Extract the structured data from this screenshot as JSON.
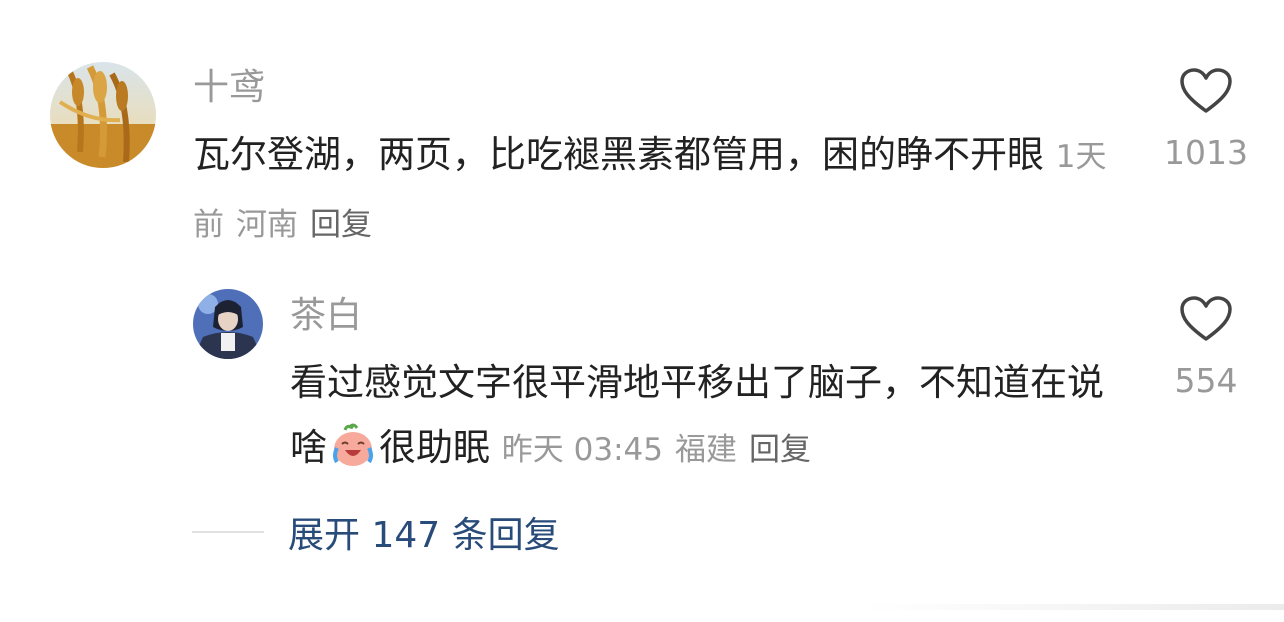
{
  "comments": [
    {
      "username": "十鸢",
      "text": "瓦尔登湖，两页，比吃褪黑素都管用，困的睁不开眼",
      "time": "1天前",
      "location": "河南",
      "reply_label": "回复",
      "like_count": "1013"
    },
    {
      "username": "茶白",
      "text_before_emoji": "看过感觉文字很平滑地平移出了脑子，不知道在说啥",
      "text_after_emoji": "很助眠",
      "time": "昨天 03:45",
      "location": "福建",
      "reply_label": "回复",
      "like_count": "554"
    }
  ],
  "expand_replies": "展开 147 条回复",
  "colors": {
    "username": "#999999",
    "body_text": "#222222",
    "meta": "#999999",
    "expand_link": "#284b7a"
  }
}
